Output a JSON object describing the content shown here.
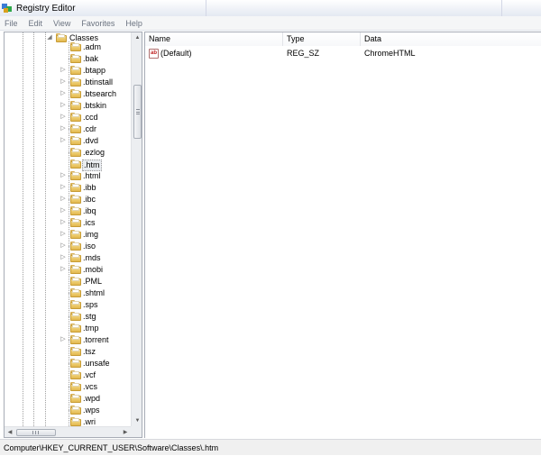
{
  "window": {
    "title": "Registry Editor"
  },
  "menu": [
    "File",
    "Edit",
    "View",
    "Favorites",
    "Help"
  ],
  "tree": {
    "root": {
      "label": "Classes",
      "expanded": true
    },
    "items": [
      {
        "label": ".adm",
        "expandable": false
      },
      {
        "label": ".bak",
        "expandable": false
      },
      {
        "label": ".btapp",
        "expandable": true
      },
      {
        "label": ".btinstall",
        "expandable": true
      },
      {
        "label": ".btsearch",
        "expandable": true
      },
      {
        "label": ".btskin",
        "expandable": true
      },
      {
        "label": ".ccd",
        "expandable": true
      },
      {
        "label": ".cdr",
        "expandable": true
      },
      {
        "label": ".dvd",
        "expandable": true
      },
      {
        "label": ".ezlog",
        "expandable": false
      },
      {
        "label": ".htm",
        "expandable": false,
        "selected": true
      },
      {
        "label": ".html",
        "expandable": true
      },
      {
        "label": ".ibb",
        "expandable": true
      },
      {
        "label": ".ibc",
        "expandable": true
      },
      {
        "label": ".ibq",
        "expandable": true
      },
      {
        "label": ".ics",
        "expandable": true
      },
      {
        "label": ".img",
        "expandable": true
      },
      {
        "label": ".iso",
        "expandable": true
      },
      {
        "label": ".mds",
        "expandable": true
      },
      {
        "label": ".mobi",
        "expandable": true
      },
      {
        "label": ".PML",
        "expandable": false
      },
      {
        "label": ".shtml",
        "expandable": false
      },
      {
        "label": ".sps",
        "expandable": false
      },
      {
        "label": ".stg",
        "expandable": false
      },
      {
        "label": ".tmp",
        "expandable": false
      },
      {
        "label": ".torrent",
        "expandable": true
      },
      {
        "label": ".tsz",
        "expandable": false
      },
      {
        "label": ".unsafe",
        "expandable": false
      },
      {
        "label": ".vcf",
        "expandable": false
      },
      {
        "label": ".vcs",
        "expandable": false
      },
      {
        "label": ".wpd",
        "expandable": false
      },
      {
        "label": ".wps",
        "expandable": false
      },
      {
        "label": ".wri",
        "expandable": false
      }
    ]
  },
  "values": {
    "columns": {
      "name": "Name",
      "type": "Type",
      "data": "Data"
    },
    "rows": [
      {
        "icon": "string-value-icon",
        "name": "(Default)",
        "type": "REG_SZ",
        "data": "ChromeHTML"
      }
    ]
  },
  "status": {
    "path": "Computer\\HKEY_CURRENT_USER\\Software\\Classes\\.htm"
  },
  "colors": {
    "folder": "#e8c05a",
    "selection": "#e9ecf0",
    "border": "#a7acb6"
  }
}
